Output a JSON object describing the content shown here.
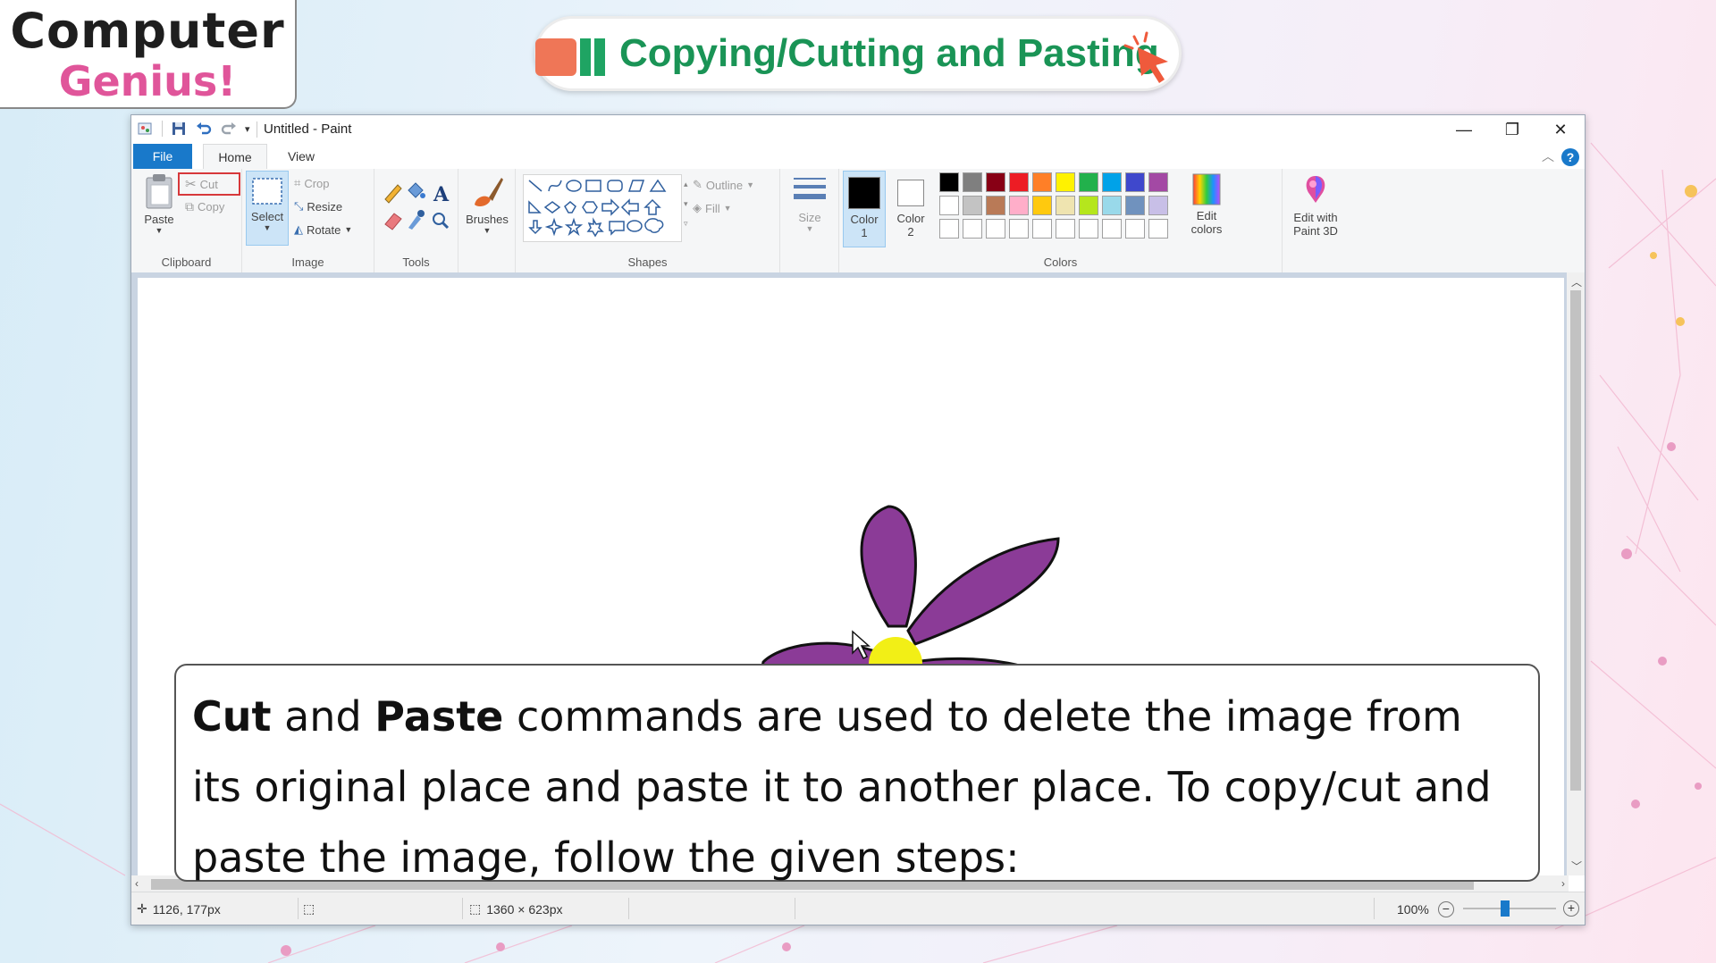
{
  "logo": {
    "line1": "Computer",
    "line2": "Genius!"
  },
  "title": "Copying/Cutting and Pasting",
  "window": {
    "title": "Untitled - Paint",
    "tabs": {
      "file": "File",
      "home": "Home",
      "view": "View"
    }
  },
  "ribbon": {
    "clipboard": {
      "label": "Clipboard",
      "paste": "Paste",
      "cut": "Cut",
      "copy": "Copy"
    },
    "image": {
      "label": "Image",
      "select": "Select",
      "crop": "Crop",
      "resize": "Resize",
      "rotate": "Rotate"
    },
    "tools": {
      "label": "Tools"
    },
    "brushes": {
      "label": "Brushes"
    },
    "shapes": {
      "label": "Shapes",
      "outline": "Outline",
      "fill": "Fill"
    },
    "size": {
      "label": "Size"
    },
    "colors": {
      "label": "Colors",
      "color1_line1": "Color",
      "color1_line2": "1",
      "color2_line1": "Color",
      "color2_line2": "2",
      "edit_colors_line1": "Edit",
      "edit_colors_line2": "colors",
      "palette_row1": [
        "#000000",
        "#7f7f7f",
        "#880015",
        "#ed1c24",
        "#ff7f27",
        "#fff200",
        "#22b14c",
        "#00a2e8",
        "#3f48cc",
        "#a349a4"
      ],
      "palette_row2": [
        "#ffffff",
        "#c3c3c3",
        "#b97a57",
        "#ffaec9",
        "#ffc90e",
        "#efe4b0",
        "#b5e61d",
        "#99d9ea",
        "#7092be",
        "#c8bfe7"
      ]
    },
    "paint3d": {
      "line1": "Edit with",
      "line2": "Paint 3D"
    }
  },
  "status": {
    "cursor_pos": "1126, 177px",
    "canvas_size": "1360 × 623px",
    "zoom": "100%"
  },
  "caption": {
    "b1": "Cut",
    "t1": " and ",
    "b2": "Paste",
    "t2": " commands are used to delete the image from its original place and paste it to another place. To copy/cut and paste the image, follow the given steps:"
  }
}
